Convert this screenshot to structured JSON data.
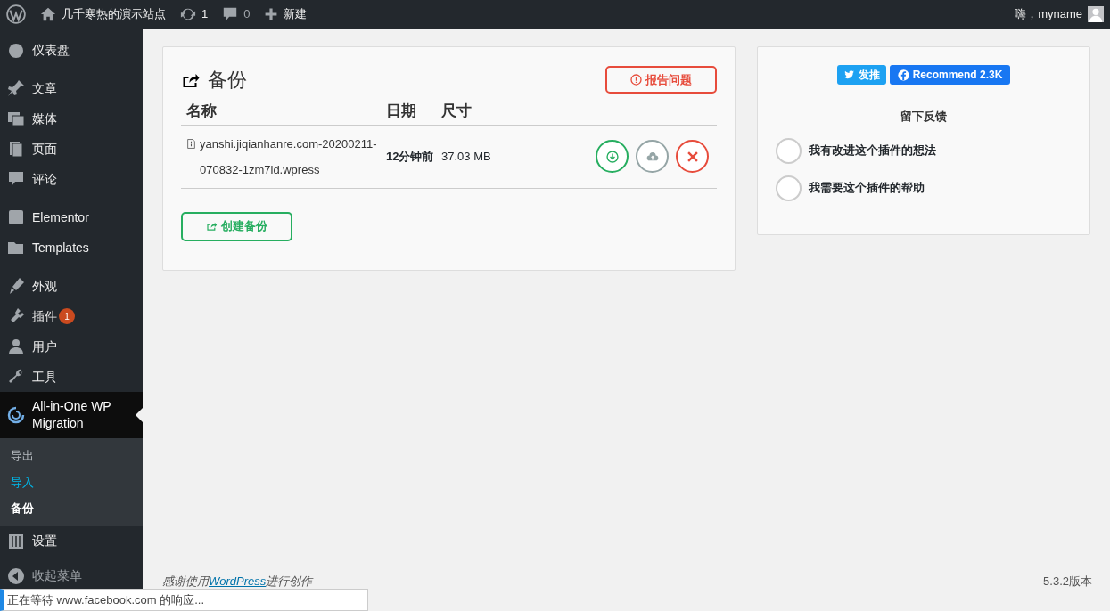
{
  "admin_bar": {
    "site_name": "几千寒热的演示站点",
    "updates_count": "1",
    "comments_count": "0",
    "new_label": "新建",
    "greeting": "嗨，myname"
  },
  "sidebar": {
    "groups": [
      [
        {
          "label": "仪表盘",
          "selected": false
        }
      ],
      [
        {
          "label": "文章",
          "selected": false
        },
        {
          "label": "媒体",
          "selected": false
        },
        {
          "label": "页面",
          "selected": false
        },
        {
          "label": "评论",
          "selected": false
        }
      ],
      [
        {
          "label": "Elementor",
          "selected": false
        },
        {
          "label": "Templates",
          "selected": false
        }
      ],
      [
        {
          "label": "外观",
          "selected": false
        },
        {
          "label": "插件",
          "selected": false,
          "badge": "1"
        },
        {
          "label": "用户",
          "selected": false
        },
        {
          "label": "工具",
          "selected": false
        },
        {
          "label": "All-in-One WP Migration",
          "selected": true,
          "children": [
            {
              "label": "导出",
              "selected": false,
              "hovered": false
            },
            {
              "label": "导入",
              "selected": false,
              "hovered": true
            },
            {
              "label": "备份",
              "selected": true,
              "hovered": false
            }
          ]
        },
        {
          "label": "设置",
          "selected": false
        }
      ]
    ],
    "collapse_label": "收起菜单"
  },
  "backups": {
    "title": "备份",
    "report_button": "报告问题",
    "columns": [
      "名称",
      "日期",
      "尺寸"
    ],
    "rows": [
      {
        "name": "yanshi.jiqianhanre.com-20200211-070832-1zm7ld.wpress",
        "date": "12分钟前",
        "size": "37.03 MB"
      }
    ],
    "create_button": "创建备份"
  },
  "feedback": {
    "tweet_button": "发推",
    "recommend_button": "Recommend 2.3K",
    "heading": "留下反馈",
    "options": [
      {
        "label": "我有改进这个插件的想法",
        "selected": false
      },
      {
        "label": "我需要这个插件的帮助",
        "selected": false
      }
    ]
  },
  "footer": {
    "thanks_before": "感谢使用",
    "thanks_link": "WordPress",
    "thanks_after": "进行创作",
    "version": "5.3.2版本"
  },
  "status_bubble": "正在等待 www.facebook.com 的响应..."
}
